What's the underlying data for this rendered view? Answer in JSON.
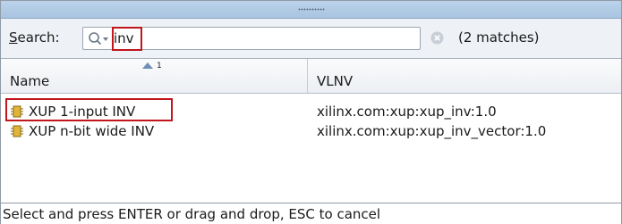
{
  "search": {
    "label": "Search:",
    "mnemonic": "S",
    "label_rest": "earch:",
    "value": "inv",
    "match_count": "(2 matches)",
    "icon": "search-icon",
    "clear_icon": "clear-icon"
  },
  "table": {
    "columns": [
      {
        "label": "Name",
        "sort_direction": "ascending",
        "sort_order": "1"
      },
      {
        "label": "VLNV"
      }
    ],
    "rows": [
      {
        "name": "XUP 1-input INV",
        "vlnv": "xilinx.com:xup:xup_inv:1.0",
        "icon": "ip-core-icon"
      },
      {
        "name": "XUP n-bit wide INV",
        "vlnv": "xilinx.com:xup:xup_inv_vector:1.0",
        "icon": "ip-core-icon"
      }
    ]
  },
  "status": {
    "text": "Select and press ENTER or drag and drop, ESC to cancel"
  },
  "colors": {
    "highlight_box": "#c0161c",
    "title_bar": "#bcd3ea",
    "ip_icon": "#c9a227"
  }
}
